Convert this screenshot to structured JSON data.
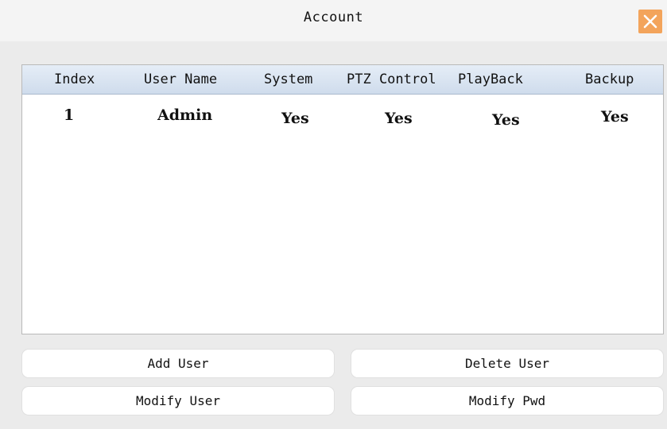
{
  "window": {
    "title": "Account",
    "close_icon": "close-icon",
    "accent": "#f3a45b"
  },
  "table": {
    "columns": [
      "Index",
      "User Name",
      "System",
      "PTZ Control",
      "PlayBack",
      "Backup"
    ],
    "rows": [
      {
        "index": "1",
        "user_name": "Admin",
        "system": "Yes",
        "ptz_control": "Yes",
        "playback": "Yes",
        "backup": "Yes"
      }
    ]
  },
  "buttons": {
    "add_user": "Add User",
    "delete_user": "Delete User",
    "modify_user": "Modify User",
    "modify_pwd": "Modify Pwd"
  }
}
